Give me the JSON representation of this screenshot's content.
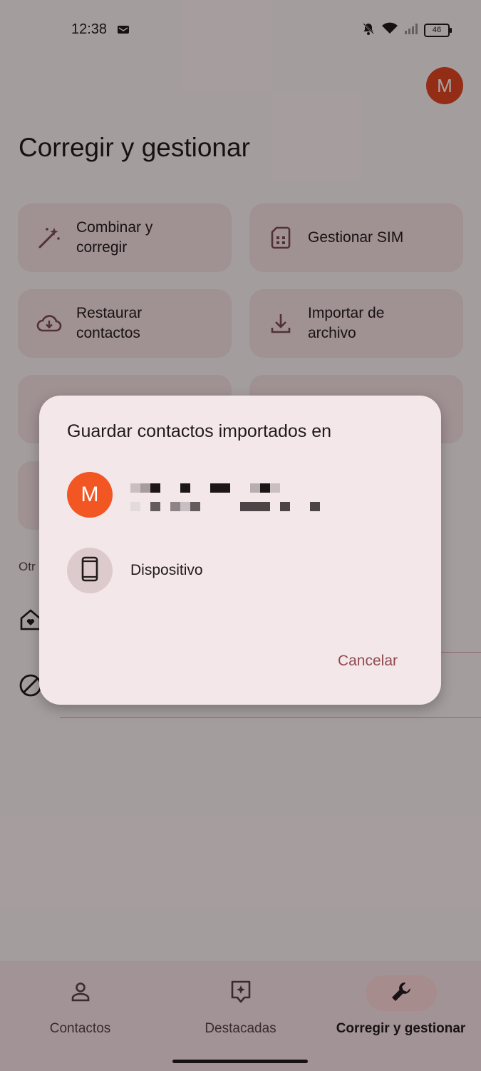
{
  "status_bar": {
    "time": "12:38",
    "battery": "46"
  },
  "header": {
    "avatar_letter": "M",
    "title": "Corregir y gestionar"
  },
  "tiles": [
    {
      "label": "Combinar y corregir",
      "icon": "magic-wand-icon"
    },
    {
      "label": "Gestionar SIM",
      "icon": "sim-card-icon"
    },
    {
      "label": "Restaurar contactos",
      "icon": "cloud-download-icon"
    },
    {
      "label": "Importar de archivo",
      "icon": "download-icon"
    }
  ],
  "section": {
    "other_label": "Otr"
  },
  "dialog": {
    "title": "Guardar contactos importados en",
    "account": {
      "avatar_letter": "M"
    },
    "device": {
      "label": "Dispositivo"
    },
    "cancel_label": "Cancelar"
  },
  "bottom_nav": [
    {
      "label": "Contactos",
      "icon": "person-icon"
    },
    {
      "label": "Destacadas",
      "icon": "star-badge-icon"
    },
    {
      "label": "Corregir y gestionar",
      "icon": "wrench-icon",
      "active": true
    }
  ],
  "colors": {
    "accent": "#904a50",
    "avatar": "#f15623",
    "tile_bg": "#f4e2e3",
    "dialog_bg": "#f4e7e9"
  }
}
